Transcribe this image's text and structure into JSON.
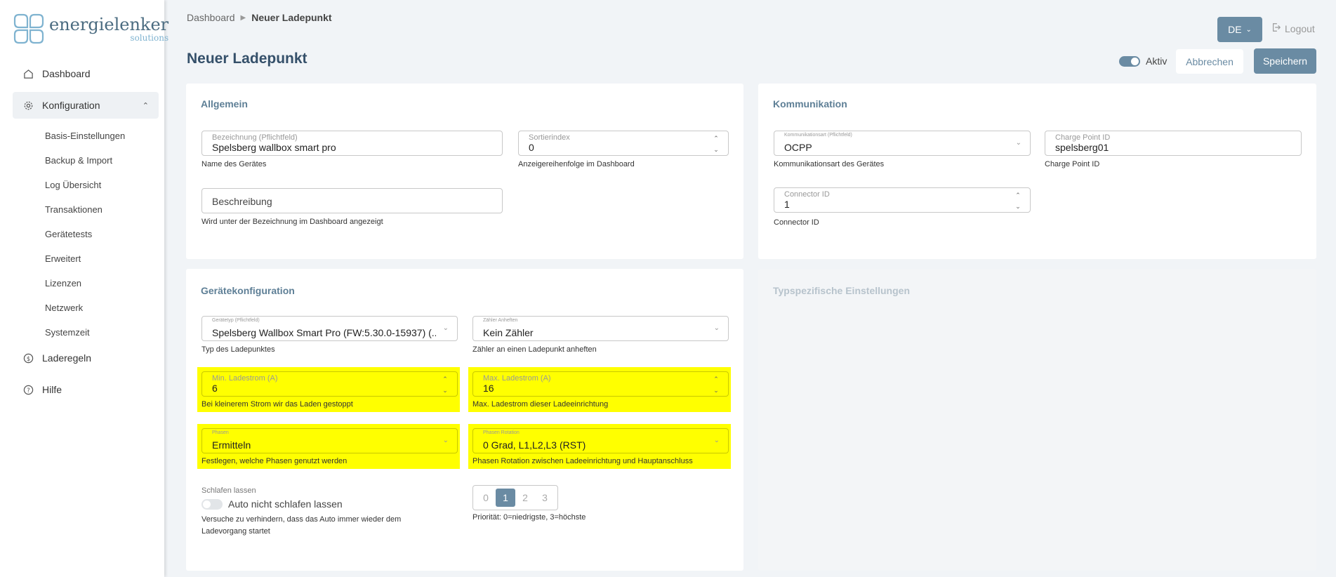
{
  "logo": {
    "name": "energielenker",
    "sub": "solutions"
  },
  "nav": {
    "dashboard": "Dashboard",
    "konfiguration": "Konfiguration",
    "sub_items": [
      "Basis-Einstellungen",
      "Backup & Import",
      "Log Übersicht",
      "Transaktionen",
      "Gerätetests",
      "Erweitert",
      "Lizenzen",
      "Netzwerk",
      "Systemzeit"
    ],
    "laderegeln": "Laderegeln",
    "hilfe": "Hilfe"
  },
  "breadcrumb": {
    "root": "Dashboard",
    "current": "Neuer Ladepunkt"
  },
  "page_title": "Neuer Ladepunkt",
  "header": {
    "lang": "DE",
    "logout": "Logout",
    "active_label": "Aktiv",
    "cancel": "Abbrechen",
    "save": "Speichern"
  },
  "allgemein": {
    "title": "Allgemein",
    "bezeichnung": {
      "label": "Bezeichnung (Pflichtfeld)",
      "value": "Spelsberg wallbox smart pro",
      "help": "Name des Gerätes"
    },
    "sortierindex": {
      "label": "Sortierindex",
      "value": "0",
      "help": "Anzeigereihenfolge im Dashboard"
    },
    "beschreibung": {
      "placeholder": "Beschreibung",
      "help": "Wird unter der Bezeichnung im Dashboard angezeigt"
    }
  },
  "kommunikation": {
    "title": "Kommunikation",
    "art": {
      "label": "Kommunikationsart (Pflichtfeld)",
      "value": "OCPP",
      "help": "Kommunikationsart des Gerätes"
    },
    "cpid": {
      "label": "Charge Point ID",
      "value": "spelsberg01",
      "help": "Charge Point ID"
    },
    "connector": {
      "label": "Connector ID",
      "value": "1",
      "help": "Connector ID"
    }
  },
  "geraete": {
    "title": "Gerätekonfiguration",
    "typ": {
      "label": "Gerätetyp (Pflichtfeld)",
      "value": "Spelsberg Wallbox Smart Pro (FW:5.30.0-15937) (...",
      "help": "Typ des Ladepunktes"
    },
    "zaehler": {
      "label": "Zähler Anheften",
      "value": "Kein Zähler",
      "help": "Zähler an einen Ladepunkt anheften"
    },
    "min": {
      "label": "Min. Ladestrom (A)",
      "value": "6",
      "help": "Bei kleinerem Strom wir das Laden gestoppt"
    },
    "max": {
      "label": "Max. Ladestrom (A)",
      "value": "16",
      "help": "Max. Ladestrom dieser Ladeeinrichtung"
    },
    "phasen": {
      "label": "Phasen",
      "value": "Ermitteln",
      "help": "Festlegen, welche Phasen genutzt werden"
    },
    "rotation": {
      "label": "Phasen Rotation",
      "value": "0 Grad, L1,L2,L3 (RST)",
      "help": "Phasen Rotation zwischen Ladeeinrichtung und Hauptanschluss"
    },
    "sleep": {
      "label": "Schlafen lassen",
      "toggle_label": "Auto nicht schlafen lassen",
      "help": "Versuche zu verhindern, dass das Auto immer wieder dem Ladevorgang startet"
    },
    "prio": {
      "options": [
        "0",
        "1",
        "2",
        "3"
      ],
      "selected": "1",
      "help": "Priorität: 0=niedrigste, 3=höchste"
    }
  },
  "typspezifisch": {
    "title": "Typspezifische Einstellungen"
  }
}
